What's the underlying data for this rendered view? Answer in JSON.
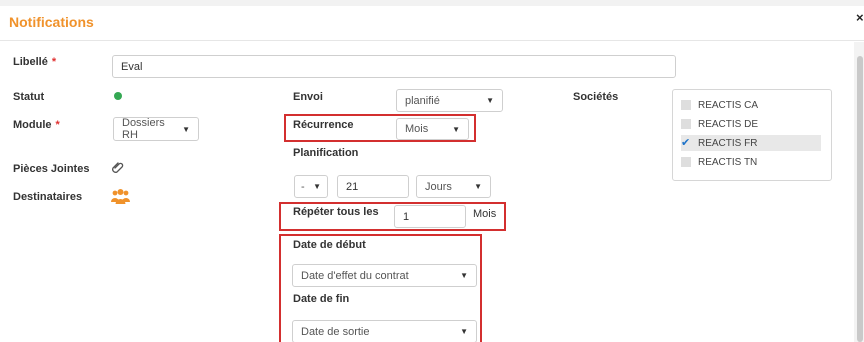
{
  "header": {
    "title": "Notifications",
    "close": "×"
  },
  "labels": {
    "libelle": "Libellé",
    "statut": "Statut",
    "module": "Module",
    "pieces": "Pièces Jointes",
    "destinataires": "Destinataires",
    "envoi": "Envoi",
    "recurrence": "Récurrence",
    "planification": "Planification",
    "repeter": "Répéter tous les",
    "date_debut": "Date de début",
    "date_fin": "Date de fin",
    "societes": "Sociétés",
    "required": "*"
  },
  "fields": {
    "libelle_value": "Eval",
    "module_value": "Dossiers RH",
    "envoi_value": "planifié",
    "recurrence_value": "Mois",
    "plan_sign": "-",
    "plan_day": "21",
    "plan_unit": "Jours",
    "repeter_value": "1",
    "repeter_unit": "Mois",
    "date_debut_value": "Date d'effet du contrat",
    "date_fin_value": "Date de sortie"
  },
  "societes": [
    {
      "label": "REACTIS CA",
      "checked": false
    },
    {
      "label": "REACTIS DE",
      "checked": false
    },
    {
      "label": "REACTIS FR",
      "checked": true
    },
    {
      "label": "REACTIS TN",
      "checked": false
    }
  ],
  "colors": {
    "accent": "#f0922b",
    "status": "#34a853",
    "highlight": "#d32f2f",
    "check": "#1e73c9"
  },
  "icons": {
    "status": "status-dot-icon",
    "attachment": "paperclip-icon",
    "recipients": "users-icon",
    "chevron": "chevron-down-icon",
    "close": "close-icon"
  }
}
